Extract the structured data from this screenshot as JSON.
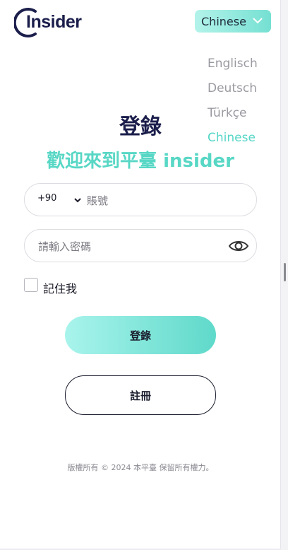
{
  "brand": {
    "logo_text": "Insider"
  },
  "language": {
    "selected": "Chinese",
    "options": [
      "Englisch",
      "Deutsch",
      "Türkçe",
      "Chinese"
    ],
    "active_index": 3
  },
  "login": {
    "title": "登錄",
    "welcome": "歡迎來到平臺 insider",
    "country_code": "+90",
    "account_placeholder": "賬號",
    "password_placeholder": "請輸入密碼",
    "remember_label": "記住我",
    "remember_checked": false,
    "login_button": "登錄",
    "register_button": "註冊"
  },
  "footer": {
    "copyright": "版權所有 © 2024 本平臺 保留所有權力。"
  },
  "colors": {
    "accent": "#58d7c5",
    "navy": "#1b1e4b",
    "muted": "#9a9aa2"
  }
}
